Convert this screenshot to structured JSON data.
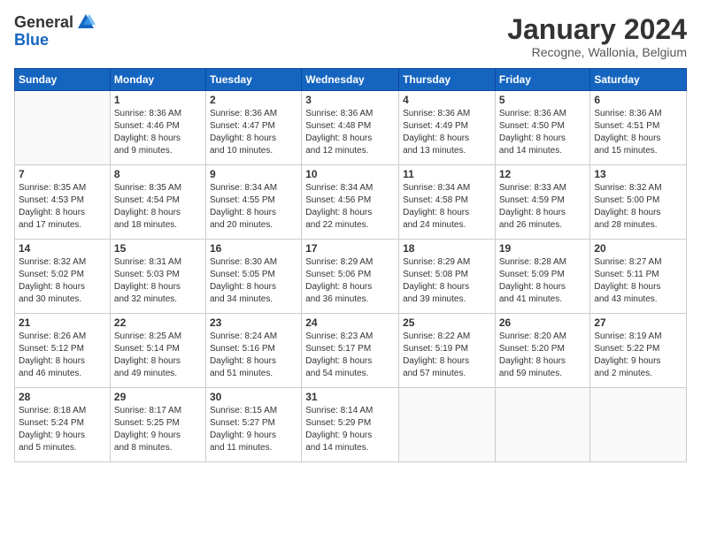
{
  "header": {
    "logo": {
      "general": "General",
      "blue": "Blue"
    },
    "title": "January 2024",
    "subtitle": "Recogne, Wallonia, Belgium"
  },
  "weekdays": [
    "Sunday",
    "Monday",
    "Tuesday",
    "Wednesday",
    "Thursday",
    "Friday",
    "Saturday"
  ],
  "weeks": [
    [
      {
        "day": "",
        "info": ""
      },
      {
        "day": "1",
        "info": "Sunrise: 8:36 AM\nSunset: 4:46 PM\nDaylight: 8 hours\nand 9 minutes."
      },
      {
        "day": "2",
        "info": "Sunrise: 8:36 AM\nSunset: 4:47 PM\nDaylight: 8 hours\nand 10 minutes."
      },
      {
        "day": "3",
        "info": "Sunrise: 8:36 AM\nSunset: 4:48 PM\nDaylight: 8 hours\nand 12 minutes."
      },
      {
        "day": "4",
        "info": "Sunrise: 8:36 AM\nSunset: 4:49 PM\nDaylight: 8 hours\nand 13 minutes."
      },
      {
        "day": "5",
        "info": "Sunrise: 8:36 AM\nSunset: 4:50 PM\nDaylight: 8 hours\nand 14 minutes."
      },
      {
        "day": "6",
        "info": "Sunrise: 8:36 AM\nSunset: 4:51 PM\nDaylight: 8 hours\nand 15 minutes."
      }
    ],
    [
      {
        "day": "7",
        "info": "Sunrise: 8:35 AM\nSunset: 4:53 PM\nDaylight: 8 hours\nand 17 minutes."
      },
      {
        "day": "8",
        "info": "Sunrise: 8:35 AM\nSunset: 4:54 PM\nDaylight: 8 hours\nand 18 minutes."
      },
      {
        "day": "9",
        "info": "Sunrise: 8:34 AM\nSunset: 4:55 PM\nDaylight: 8 hours\nand 20 minutes."
      },
      {
        "day": "10",
        "info": "Sunrise: 8:34 AM\nSunset: 4:56 PM\nDaylight: 8 hours\nand 22 minutes."
      },
      {
        "day": "11",
        "info": "Sunrise: 8:34 AM\nSunset: 4:58 PM\nDaylight: 8 hours\nand 24 minutes."
      },
      {
        "day": "12",
        "info": "Sunrise: 8:33 AM\nSunset: 4:59 PM\nDaylight: 8 hours\nand 26 minutes."
      },
      {
        "day": "13",
        "info": "Sunrise: 8:32 AM\nSunset: 5:00 PM\nDaylight: 8 hours\nand 28 minutes."
      }
    ],
    [
      {
        "day": "14",
        "info": "Sunrise: 8:32 AM\nSunset: 5:02 PM\nDaylight: 8 hours\nand 30 minutes."
      },
      {
        "day": "15",
        "info": "Sunrise: 8:31 AM\nSunset: 5:03 PM\nDaylight: 8 hours\nand 32 minutes."
      },
      {
        "day": "16",
        "info": "Sunrise: 8:30 AM\nSunset: 5:05 PM\nDaylight: 8 hours\nand 34 minutes."
      },
      {
        "day": "17",
        "info": "Sunrise: 8:29 AM\nSunset: 5:06 PM\nDaylight: 8 hours\nand 36 minutes."
      },
      {
        "day": "18",
        "info": "Sunrise: 8:29 AM\nSunset: 5:08 PM\nDaylight: 8 hours\nand 39 minutes."
      },
      {
        "day": "19",
        "info": "Sunrise: 8:28 AM\nSunset: 5:09 PM\nDaylight: 8 hours\nand 41 minutes."
      },
      {
        "day": "20",
        "info": "Sunrise: 8:27 AM\nSunset: 5:11 PM\nDaylight: 8 hours\nand 43 minutes."
      }
    ],
    [
      {
        "day": "21",
        "info": "Sunrise: 8:26 AM\nSunset: 5:12 PM\nDaylight: 8 hours\nand 46 minutes."
      },
      {
        "day": "22",
        "info": "Sunrise: 8:25 AM\nSunset: 5:14 PM\nDaylight: 8 hours\nand 49 minutes."
      },
      {
        "day": "23",
        "info": "Sunrise: 8:24 AM\nSunset: 5:16 PM\nDaylight: 8 hours\nand 51 minutes."
      },
      {
        "day": "24",
        "info": "Sunrise: 8:23 AM\nSunset: 5:17 PM\nDaylight: 8 hours\nand 54 minutes."
      },
      {
        "day": "25",
        "info": "Sunrise: 8:22 AM\nSunset: 5:19 PM\nDaylight: 8 hours\nand 57 minutes."
      },
      {
        "day": "26",
        "info": "Sunrise: 8:20 AM\nSunset: 5:20 PM\nDaylight: 8 hours\nand 59 minutes."
      },
      {
        "day": "27",
        "info": "Sunrise: 8:19 AM\nSunset: 5:22 PM\nDaylight: 9 hours\nand 2 minutes."
      }
    ],
    [
      {
        "day": "28",
        "info": "Sunrise: 8:18 AM\nSunset: 5:24 PM\nDaylight: 9 hours\nand 5 minutes."
      },
      {
        "day": "29",
        "info": "Sunrise: 8:17 AM\nSunset: 5:25 PM\nDaylight: 9 hours\nand 8 minutes."
      },
      {
        "day": "30",
        "info": "Sunrise: 8:15 AM\nSunset: 5:27 PM\nDaylight: 9 hours\nand 11 minutes."
      },
      {
        "day": "31",
        "info": "Sunrise: 8:14 AM\nSunset: 5:29 PM\nDaylight: 9 hours\nand 14 minutes."
      },
      {
        "day": "",
        "info": ""
      },
      {
        "day": "",
        "info": ""
      },
      {
        "day": "",
        "info": ""
      }
    ]
  ]
}
